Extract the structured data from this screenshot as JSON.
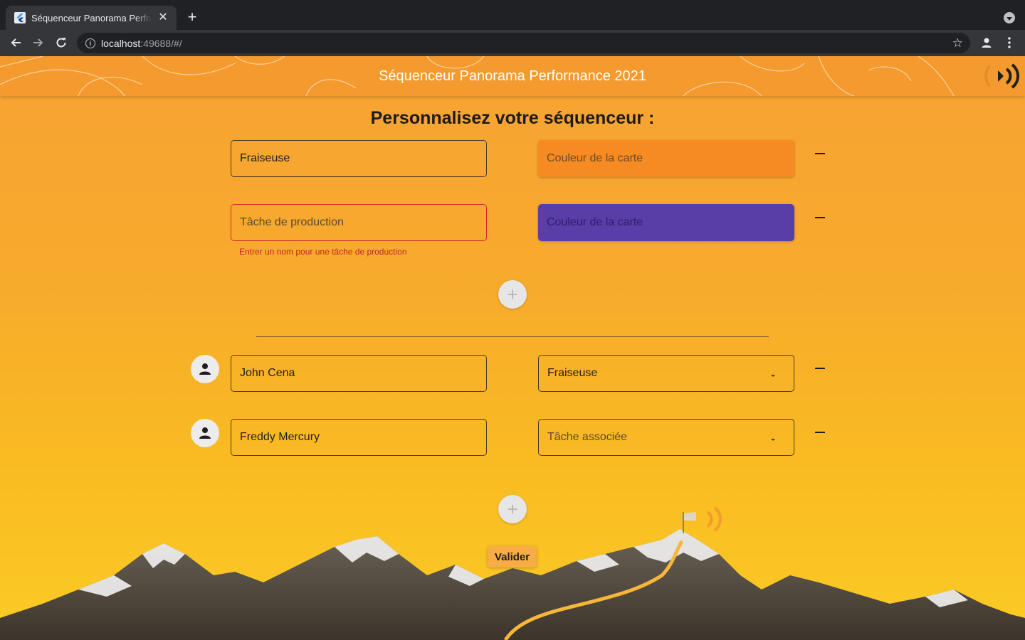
{
  "browser": {
    "tab_title": "Séquenceur Panorama Performance 2021",
    "tab_close": "✕",
    "new_tab": "+",
    "url_host": "localhost",
    "url_rest": ":49688/#/",
    "info": "i",
    "star": "☆"
  },
  "app": {
    "title": "Séquenceur Panorama Performance 2021",
    "heading": "Personnalisez votre séquenceur :"
  },
  "tasks": [
    {
      "name": "Fraiseuse",
      "name_is_placeholder": false,
      "color_label": "Couleur de la carte",
      "color": "#f58b22"
    },
    {
      "name": "Tâche de production",
      "name_is_placeholder": true,
      "color_label": "Couleur de la carte",
      "color": "#5a3ea8",
      "error": "Entrer un nom pour une tâche de production"
    }
  ],
  "add_symbol": "+",
  "operators": [
    {
      "name": "John Cena",
      "task": "Fraiseuse",
      "task_is_placeholder": false
    },
    {
      "name": "Freddy Mercury",
      "task": "Tâche associée",
      "task_is_placeholder": true
    }
  ],
  "submit_label": "Valider",
  "colors": {
    "accent": "#f59a2e",
    "error": "#d32f2f",
    "orange_card": "#f58b22",
    "purple_card": "#5a3ea8"
  }
}
